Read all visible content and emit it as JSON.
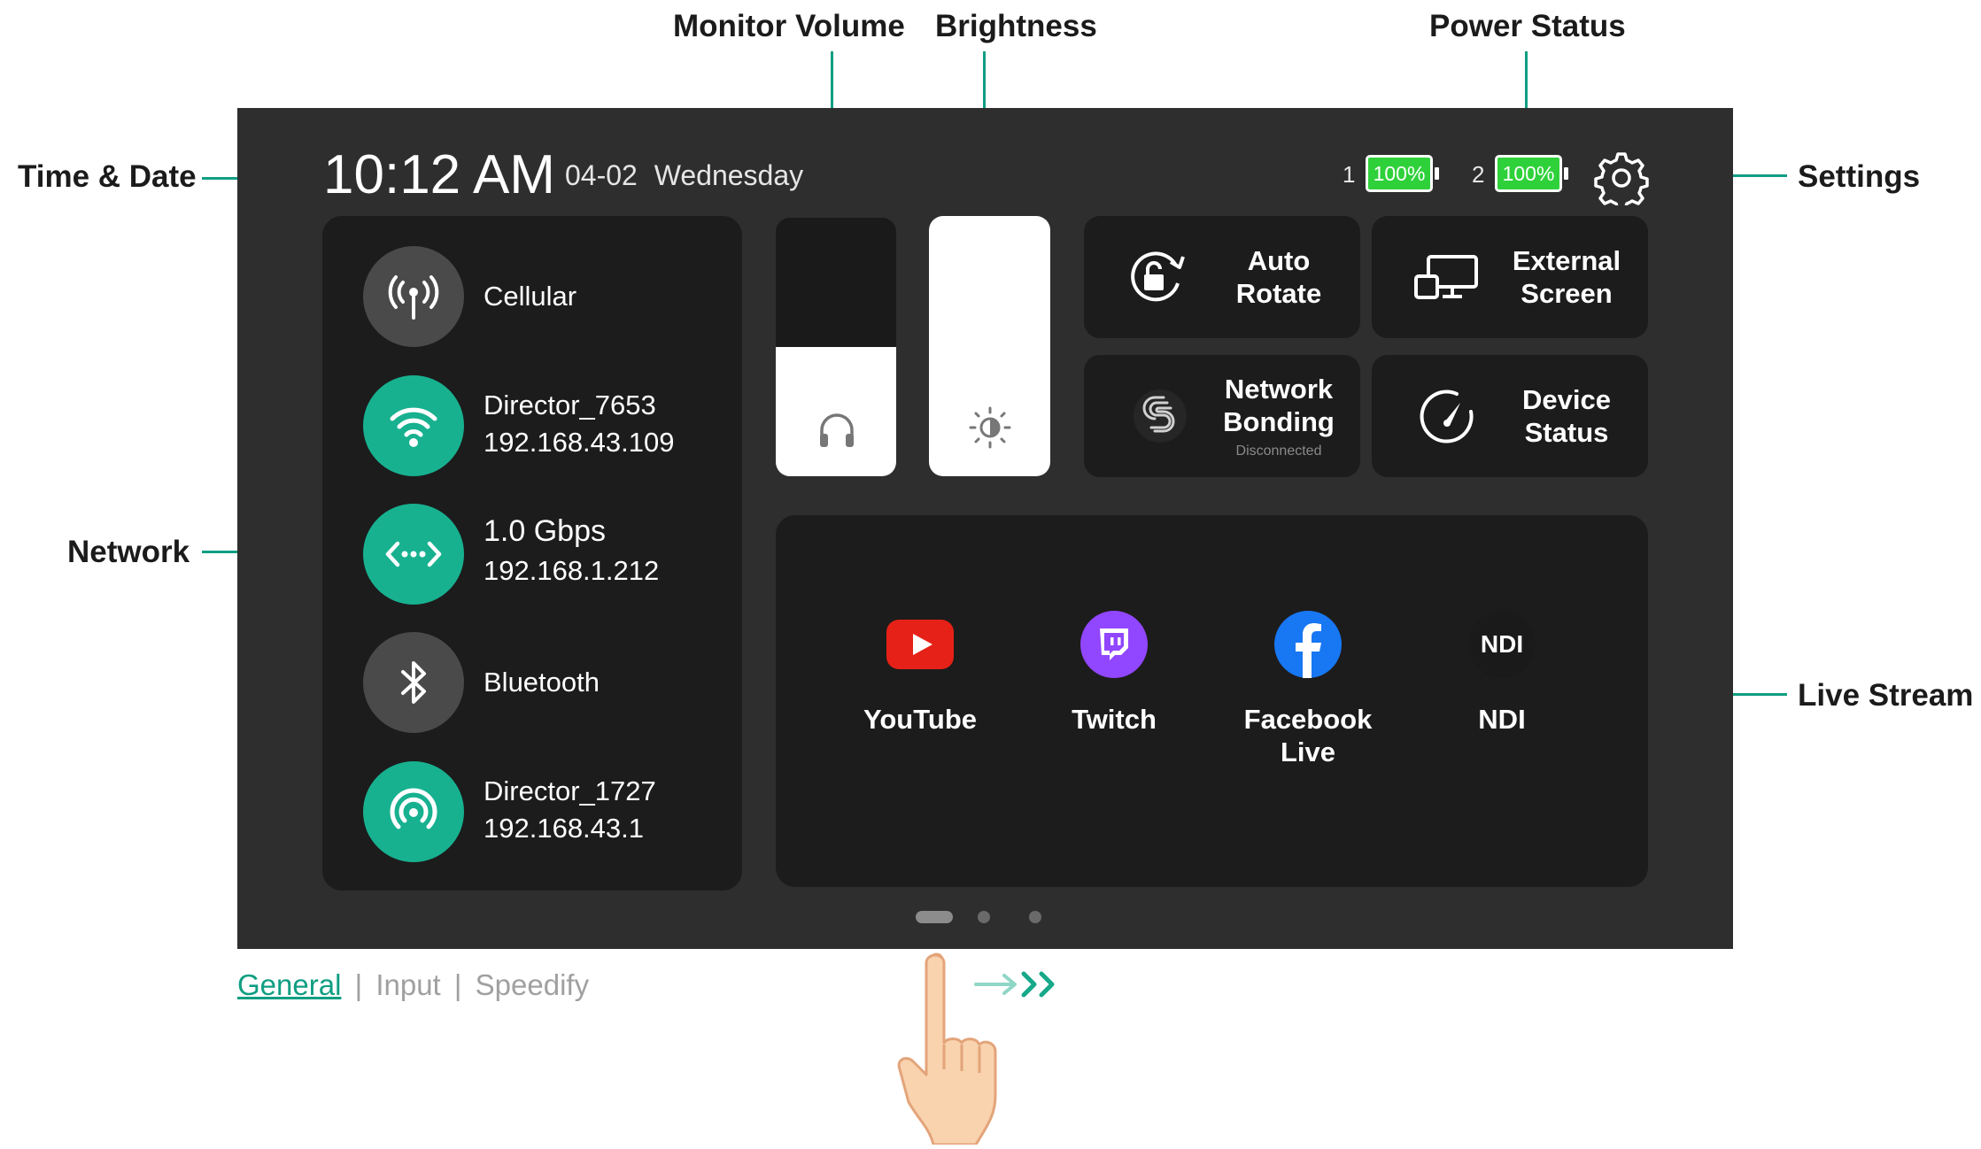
{
  "callouts": {
    "time_date": "Time & Date",
    "network": "Network",
    "monitor_volume": "Monitor Volume",
    "brightness": "Brightness",
    "power_status": "Power Status",
    "settings": "Settings",
    "live_stream": "Live Stream"
  },
  "status_bar": {
    "time": "10:12 AM",
    "date": "04-02",
    "weekday": "Wednesday",
    "batteries": [
      {
        "index": "1",
        "level": "100%"
      },
      {
        "index": "2",
        "level": "100%"
      }
    ]
  },
  "network": {
    "items": [
      {
        "icon": "cellular-antenna-icon",
        "line1": "Cellular",
        "line2": "",
        "active": false
      },
      {
        "icon": "wifi-icon",
        "line1": "Director_7653",
        "line2": "192.168.43.109",
        "active": true
      },
      {
        "icon": "ethernet-icon",
        "line1": "1.0 Gbps",
        "line2": "192.168.1.212",
        "active": true
      },
      {
        "icon": "bluetooth-icon",
        "line1": "Bluetooth",
        "line2": "",
        "active": false
      },
      {
        "icon": "hotspot-icon",
        "line1": "Director_1727",
        "line2": "192.168.43.1",
        "active": true
      }
    ]
  },
  "sliders": {
    "monitor_volume_level": 0.5,
    "brightness_level": 1.0
  },
  "tiles": {
    "auto_rotate": "Auto Rotate",
    "external_screen": "External Screen",
    "network_bonding": "Network Bonding",
    "network_bonding_status": "Disconnected",
    "device_status": "Device Status"
  },
  "live_stream": {
    "items": [
      {
        "label": "YouTube",
        "icon": "youtube-icon",
        "color": "#e62117"
      },
      {
        "label": "Twitch",
        "icon": "twitch-icon",
        "color": "#9146ff"
      },
      {
        "label": "Facebook Live",
        "icon": "facebook-icon",
        "color": "#1877f2"
      },
      {
        "label": "NDI",
        "icon": "ndi-icon",
        "color": "#1a1a1a"
      }
    ]
  },
  "pager": {
    "pages": 3,
    "current": 1
  },
  "bottom_tabs": {
    "general": "General",
    "input": "Input",
    "speedify": "Speedify",
    "separator": "|"
  },
  "colors": {
    "accent": "#0f9e82",
    "tile_teal": "#17b190",
    "screen_bg": "#2e2e2e",
    "panel_bg": "#1c1c1c",
    "battery_green": "#2fd13a"
  }
}
